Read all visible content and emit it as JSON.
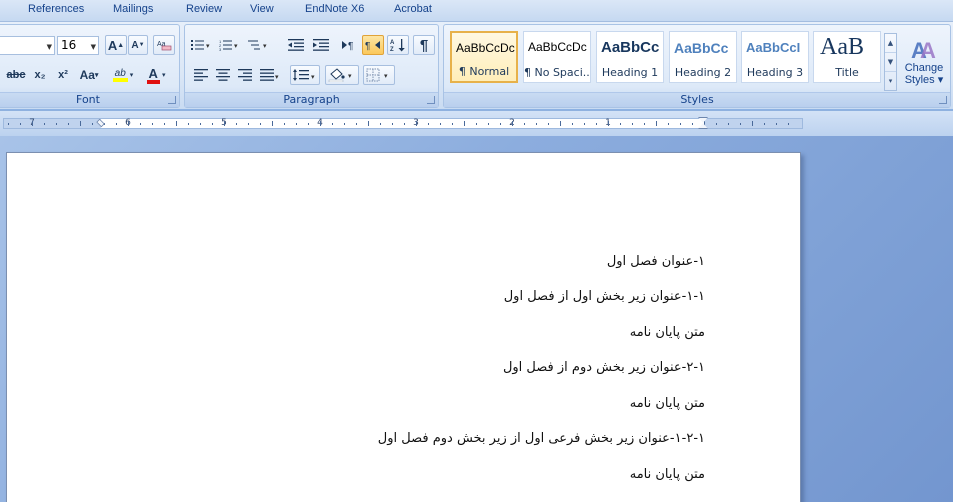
{
  "tabs": [
    {
      "label": "References"
    },
    {
      "label": "Mailings"
    },
    {
      "label": "Review"
    },
    {
      "label": "View"
    },
    {
      "label": "EndNote X6"
    },
    {
      "label": "Acrobat"
    }
  ],
  "font_group": {
    "label": "Font",
    "font_size": "16",
    "grow_label": "A",
    "shrink_label": "A",
    "strikethrough_label": "abc",
    "subscript_label": "x₂",
    "superscript_label": "x²",
    "change_case_label": "Aa",
    "highlight_label": "ab",
    "font_color_label": "A",
    "highlight_color": "#ffff00",
    "font_color": "#e01010"
  },
  "paragraph_group": {
    "label": "Paragraph",
    "pilcrow": "¶"
  },
  "styles_group": {
    "label": "Styles",
    "items": [
      {
        "preview": "AaBbCcDc",
        "name": "¶ Normal"
      },
      {
        "preview": "AaBbCcDc",
        "name": "¶ No Spaci..."
      },
      {
        "preview": "AaBbCc",
        "name": "Heading 1"
      },
      {
        "preview": "AaBbCc",
        "name": "Heading 2"
      },
      {
        "preview": "AaBbCcI",
        "name": "Heading 3"
      },
      {
        "preview": "AaB",
        "name": "Title"
      }
    ],
    "change_styles_line1": "Change",
    "change_styles_line2": "Styles ▾"
  },
  "ruler": {
    "numbers": [
      "7",
      "6",
      "5",
      "4",
      "3",
      "2",
      "1"
    ]
  },
  "document": {
    "lines": [
      "١-عنوان فصل اول",
      "١-١-عنوان زیر بخش اول از فصل اول",
      "متن پایان نامه",
      "١-٢-عنوان زیر بخش دوم از فصل اول",
      "متن پایان نامه",
      "١-٢-١-عنوان زیر بخش فرعی اول از زیر بخش دوم فصل اول",
      "متن پایان نامه"
    ]
  }
}
